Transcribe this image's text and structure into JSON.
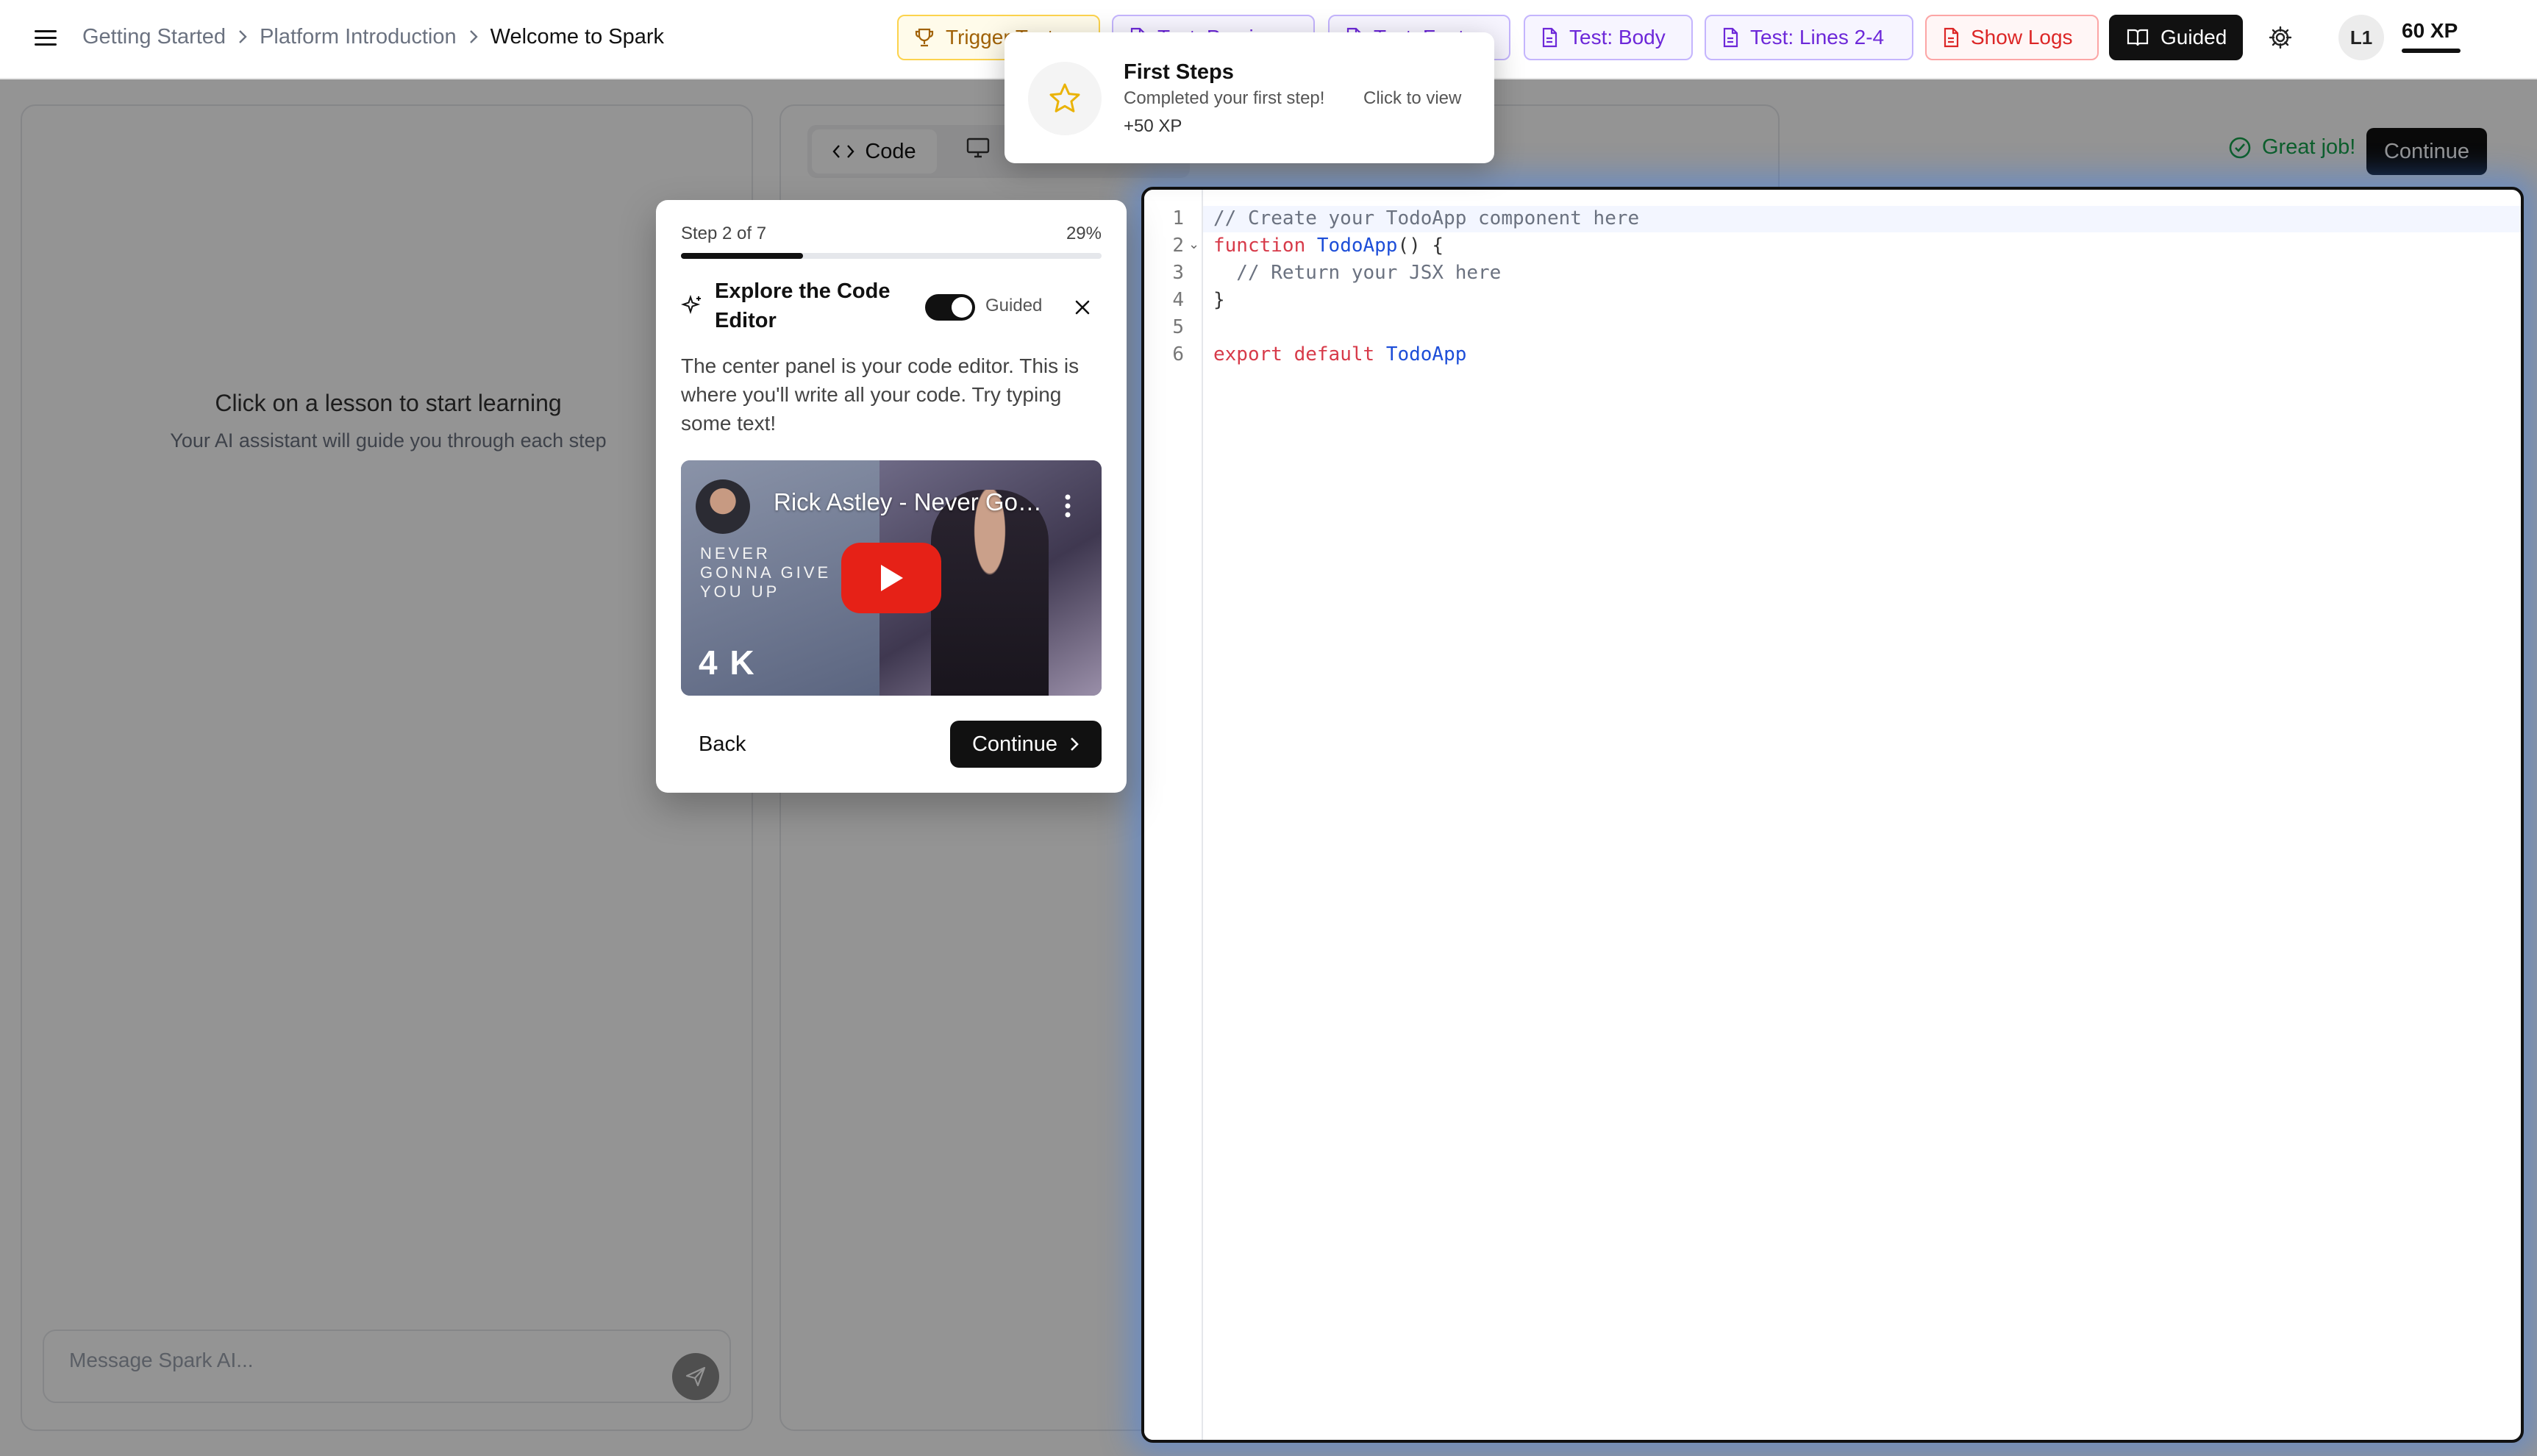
{
  "header": {
    "breadcrumb": [
      "Getting Started",
      "Platform Introduction",
      "Welcome to Spark"
    ],
    "toolbar": [
      {
        "label": "Trigger Test",
        "style": "amber",
        "icon": "trophy-icon"
      },
      {
        "label": "Test: Preview",
        "style": "purple",
        "icon": "file-icon"
      },
      {
        "label": "Test: Footer",
        "style": "purple",
        "icon": "file-icon"
      },
      {
        "label": "Test: Body",
        "style": "purple",
        "icon": "file-icon"
      },
      {
        "label": "Test: Lines 2-4",
        "style": "purple",
        "icon": "file-icon"
      },
      {
        "label": "Show Logs",
        "style": "red",
        "icon": "file-icon"
      }
    ],
    "guided_label": "Guided",
    "avatar": "L1",
    "xp": "60 XP"
  },
  "left_panel": {
    "empty_title": "Click on a lesson to start learning",
    "empty_subtitle": "Your AI assistant will guide you through each step",
    "message_placeholder": "Message Spark AI..."
  },
  "center": {
    "tab_code": "Code",
    "status": "Great job!",
    "continue_label": "Continue"
  },
  "editor": {
    "lines": [
      {
        "n": "1",
        "tokens": [
          {
            "t": "// Create your TodoApp component here",
            "c": "cm"
          }
        ]
      },
      {
        "n": "2",
        "tokens": [
          {
            "t": "function ",
            "c": "kw"
          },
          {
            "t": "TodoApp",
            "c": "fn"
          },
          {
            "t": "() {",
            "c": "pn"
          }
        ]
      },
      {
        "n": "3",
        "tokens": [
          {
            "t": "  // Return your JSX here",
            "c": "cm"
          }
        ]
      },
      {
        "n": "4",
        "tokens": [
          {
            "t": "}",
            "c": "pn"
          }
        ]
      },
      {
        "n": "5",
        "tokens": []
      },
      {
        "n": "6",
        "tokens": [
          {
            "t": "export ",
            "c": "kw"
          },
          {
            "t": "default ",
            "c": "kw"
          },
          {
            "t": "TodoApp",
            "c": "fn"
          }
        ]
      }
    ]
  },
  "tour": {
    "step_label": "Step 2 of 7",
    "percent_label": "29%",
    "progress": 0.29,
    "title": "Explore the Code Editor",
    "guided_label": "Guided",
    "description": "The center panel is your code editor. This is where you'll write all your code. Try typing some text!",
    "video": {
      "title": "Rick Astley - Never Gonna Give You Up (Official Video)",
      "overlay_text": "NEVER GONNA GIVE YOU UP",
      "badge": "4 K"
    },
    "back_label": "Back",
    "continue_label": "Continue"
  },
  "toast": {
    "title": "First Steps",
    "description": "Completed your first step!",
    "cta": "Click to view",
    "xp": "+50 XP"
  },
  "colors": {
    "accent": "#111111",
    "success": "#16a34a",
    "purple": "#6d28d9",
    "amber": "#a16207",
    "red": "#dc2626",
    "editor_glow": "#3b82f6",
    "youtube_red": "#e62117"
  }
}
